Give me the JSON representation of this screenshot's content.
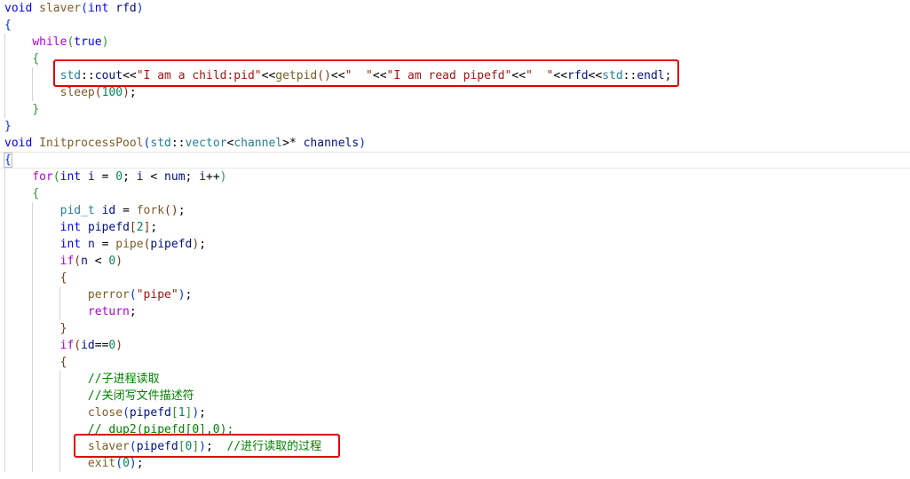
{
  "code_lines": [
    {
      "tokens": [
        {
          "t": "void",
          "c": "kw"
        },
        {
          "t": " ",
          "c": "pl"
        },
        {
          "t": "slaver",
          "c": "fn"
        },
        {
          "t": "(",
          "c": "b1"
        },
        {
          "t": "int",
          "c": "kw"
        },
        {
          "t": " ",
          "c": "pl"
        },
        {
          "t": "rfd",
          "c": "var"
        },
        {
          "t": ")",
          "c": "b1"
        }
      ]
    },
    {
      "tokens": [
        {
          "t": "{",
          "c": "b1"
        }
      ]
    },
    {
      "tokens": [
        {
          "t": "    ",
          "c": "pl"
        },
        {
          "t": "while",
          "c": "ctl"
        },
        {
          "t": "(",
          "c": "b2"
        },
        {
          "t": "true",
          "c": "kw"
        },
        {
          "t": ")",
          "c": "b2"
        }
      ]
    },
    {
      "tokens": [
        {
          "t": "    ",
          "c": "pl"
        },
        {
          "t": "{",
          "c": "b2"
        }
      ]
    },
    {
      "tokens": [
        {
          "t": "        ",
          "c": "pl"
        },
        {
          "t": "std",
          "c": "ty"
        },
        {
          "t": "::",
          "c": "pl"
        },
        {
          "t": "cout",
          "c": "var"
        },
        {
          "t": "<<",
          "c": "pl"
        },
        {
          "t": "\"I am a child:pid\"",
          "c": "str"
        },
        {
          "t": "<<",
          "c": "pl"
        },
        {
          "t": "getpid",
          "c": "fn"
        },
        {
          "t": "()",
          "c": "b3"
        },
        {
          "t": "<<",
          "c": "pl"
        },
        {
          "t": "\"  \"",
          "c": "str"
        },
        {
          "t": "<<",
          "c": "pl"
        },
        {
          "t": "\"I am read pipefd\"",
          "c": "str"
        },
        {
          "t": "<<",
          "c": "pl"
        },
        {
          "t": "\"  \"",
          "c": "str"
        },
        {
          "t": "<<",
          "c": "pl"
        },
        {
          "t": "rfd",
          "c": "var"
        },
        {
          "t": "<<",
          "c": "pl"
        },
        {
          "t": "std",
          "c": "ty"
        },
        {
          "t": "::",
          "c": "pl"
        },
        {
          "t": "endl",
          "c": "var"
        },
        {
          "t": ";",
          "c": "pl"
        }
      ]
    },
    {
      "tokens": [
        {
          "t": "        ",
          "c": "pl"
        },
        {
          "t": "sleep",
          "c": "fn"
        },
        {
          "t": "(",
          "c": "b3"
        },
        {
          "t": "100",
          "c": "num"
        },
        {
          "t": ")",
          "c": "b3"
        },
        {
          "t": ";",
          "c": "pl"
        }
      ]
    },
    {
      "tokens": [
        {
          "t": "    ",
          "c": "pl"
        },
        {
          "t": "}",
          "c": "b2"
        }
      ]
    },
    {
      "tokens": [
        {
          "t": "}",
          "c": "b1"
        }
      ]
    },
    {
      "tokens": [
        {
          "t": "void",
          "c": "kw"
        },
        {
          "t": " ",
          "c": "pl"
        },
        {
          "t": "InitprocessPool",
          "c": "fn"
        },
        {
          "t": "(",
          "c": "b1"
        },
        {
          "t": "std",
          "c": "ty"
        },
        {
          "t": "::",
          "c": "pl"
        },
        {
          "t": "vector",
          "c": "ty"
        },
        {
          "t": "<",
          "c": "pl"
        },
        {
          "t": "channel",
          "c": "ty"
        },
        {
          "t": ">",
          "c": "pl"
        },
        {
          "t": "*",
          "c": "pl"
        },
        {
          "t": " ",
          "c": "pl"
        },
        {
          "t": "channels",
          "c": "var"
        },
        {
          "t": ")",
          "c": "b1"
        }
      ]
    },
    {
      "tokens": [
        {
          "t": "{",
          "c": "b1 cursor-brace"
        }
      ],
      "current": true
    },
    {
      "tokens": [
        {
          "t": "    ",
          "c": "pl"
        },
        {
          "t": "for",
          "c": "ctl"
        },
        {
          "t": "(",
          "c": "b2"
        },
        {
          "t": "int",
          "c": "kw"
        },
        {
          "t": " ",
          "c": "pl"
        },
        {
          "t": "i",
          "c": "var"
        },
        {
          "t": " = ",
          "c": "pl"
        },
        {
          "t": "0",
          "c": "num"
        },
        {
          "t": "; ",
          "c": "pl"
        },
        {
          "t": "i",
          "c": "var"
        },
        {
          "t": " < ",
          "c": "pl"
        },
        {
          "t": "num",
          "c": "var"
        },
        {
          "t": "; ",
          "c": "pl"
        },
        {
          "t": "i",
          "c": "var"
        },
        {
          "t": "++",
          "c": "pl"
        },
        {
          "t": ")",
          "c": "b2"
        }
      ]
    },
    {
      "tokens": [
        {
          "t": "    ",
          "c": "pl"
        },
        {
          "t": "{",
          "c": "b2"
        }
      ]
    },
    {
      "tokens": [
        {
          "t": "        ",
          "c": "pl"
        },
        {
          "t": "pid_t",
          "c": "ty"
        },
        {
          "t": " ",
          "c": "pl"
        },
        {
          "t": "id",
          "c": "var"
        },
        {
          "t": " = ",
          "c": "pl"
        },
        {
          "t": "fork",
          "c": "fn"
        },
        {
          "t": "()",
          "c": "b3"
        },
        {
          "t": ";",
          "c": "pl"
        }
      ]
    },
    {
      "tokens": [
        {
          "t": "        ",
          "c": "pl"
        },
        {
          "t": "int",
          "c": "kw"
        },
        {
          "t": " ",
          "c": "pl"
        },
        {
          "t": "pipefd",
          "c": "var"
        },
        {
          "t": "[",
          "c": "b3"
        },
        {
          "t": "2",
          "c": "num"
        },
        {
          "t": "]",
          "c": "b3"
        },
        {
          "t": ";",
          "c": "pl"
        }
      ]
    },
    {
      "tokens": [
        {
          "t": "        ",
          "c": "pl"
        },
        {
          "t": "int",
          "c": "kw"
        },
        {
          "t": " ",
          "c": "pl"
        },
        {
          "t": "n",
          "c": "var"
        },
        {
          "t": " = ",
          "c": "pl"
        },
        {
          "t": "pipe",
          "c": "fn"
        },
        {
          "t": "(",
          "c": "b3"
        },
        {
          "t": "pipefd",
          "c": "var"
        },
        {
          "t": ")",
          "c": "b3"
        },
        {
          "t": ";",
          "c": "pl"
        }
      ]
    },
    {
      "tokens": [
        {
          "t": "        ",
          "c": "pl"
        },
        {
          "t": "if",
          "c": "ctl"
        },
        {
          "t": "(",
          "c": "b3"
        },
        {
          "t": "n",
          "c": "var"
        },
        {
          "t": " < ",
          "c": "pl"
        },
        {
          "t": "0",
          "c": "num"
        },
        {
          "t": ")",
          "c": "b3"
        }
      ]
    },
    {
      "tokens": [
        {
          "t": "        ",
          "c": "pl"
        },
        {
          "t": "{",
          "c": "b3"
        }
      ]
    },
    {
      "tokens": [
        {
          "t": "            ",
          "c": "pl"
        },
        {
          "t": "perror",
          "c": "fn"
        },
        {
          "t": "(",
          "c": "b1"
        },
        {
          "t": "\"pipe\"",
          "c": "str"
        },
        {
          "t": ")",
          "c": "b1"
        },
        {
          "t": ";",
          "c": "pl"
        }
      ]
    },
    {
      "tokens": [
        {
          "t": "            ",
          "c": "pl"
        },
        {
          "t": "return",
          "c": "ctl"
        },
        {
          "t": ";",
          "c": "pl"
        }
      ]
    },
    {
      "tokens": [
        {
          "t": "        ",
          "c": "pl"
        },
        {
          "t": "}",
          "c": "b3"
        }
      ]
    },
    {
      "tokens": [
        {
          "t": "        ",
          "c": "pl"
        },
        {
          "t": "if",
          "c": "ctl"
        },
        {
          "t": "(",
          "c": "b3"
        },
        {
          "t": "id",
          "c": "var"
        },
        {
          "t": "==",
          "c": "pl"
        },
        {
          "t": "0",
          "c": "num"
        },
        {
          "t": ")",
          "c": "b3"
        }
      ]
    },
    {
      "tokens": [
        {
          "t": "        ",
          "c": "pl"
        },
        {
          "t": "{",
          "c": "b3"
        }
      ]
    },
    {
      "tokens": [
        {
          "t": "            ",
          "c": "pl"
        },
        {
          "t": "//子进程读取",
          "c": "cm"
        }
      ]
    },
    {
      "tokens": [
        {
          "t": "            ",
          "c": "pl"
        },
        {
          "t": "//关闭写文件描述符",
          "c": "cm"
        }
      ]
    },
    {
      "tokens": [
        {
          "t": "            ",
          "c": "pl"
        },
        {
          "t": "close",
          "c": "fn"
        },
        {
          "t": "(",
          "c": "b1"
        },
        {
          "t": "pipefd",
          "c": "var"
        },
        {
          "t": "[",
          "c": "b2"
        },
        {
          "t": "1",
          "c": "num"
        },
        {
          "t": "]",
          "c": "b2"
        },
        {
          "t": ")",
          "c": "b1"
        },
        {
          "t": ";",
          "c": "pl"
        }
      ]
    },
    {
      "tokens": [
        {
          "t": "            ",
          "c": "pl"
        },
        {
          "t": "// dup2(pipefd[0],0);",
          "c": "cm"
        }
      ]
    },
    {
      "tokens": [
        {
          "t": "            ",
          "c": "pl"
        },
        {
          "t": "slaver",
          "c": "fn"
        },
        {
          "t": "(",
          "c": "b1"
        },
        {
          "t": "pipefd",
          "c": "var"
        },
        {
          "t": "[",
          "c": "b2"
        },
        {
          "t": "0",
          "c": "num"
        },
        {
          "t": "]",
          "c": "b2"
        },
        {
          "t": ")",
          "c": "b1"
        },
        {
          "t": ";  ",
          "c": "pl"
        },
        {
          "t": "//进行读取的过程",
          "c": "cm"
        }
      ]
    },
    {
      "tokens": [
        {
          "t": "            ",
          "c": "pl"
        },
        {
          "t": "exit",
          "c": "fn"
        },
        {
          "t": "(",
          "c": "b1"
        },
        {
          "t": "0",
          "c": "num"
        },
        {
          "t": ")",
          "c": "b1"
        },
        {
          "t": ";",
          "c": "pl"
        }
      ]
    }
  ]
}
